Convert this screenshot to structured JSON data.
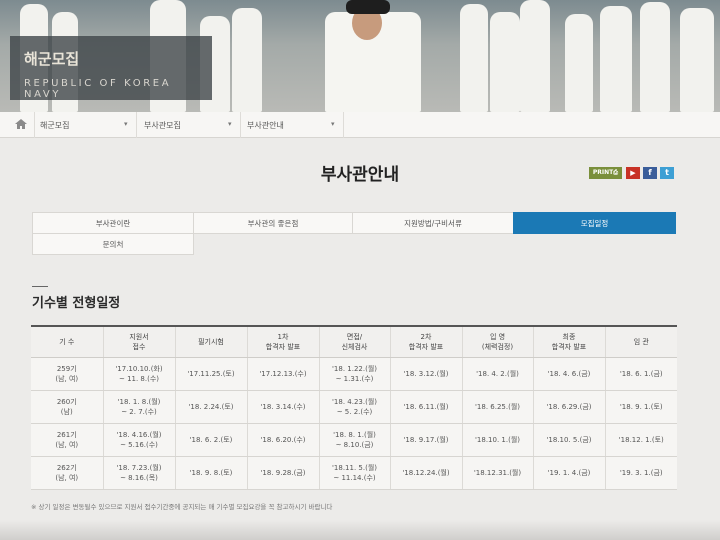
{
  "hero": {
    "title": "해군모집",
    "subtitle": "REPUBLIC OF KOREA NAVY"
  },
  "breadcrumb": {
    "items": [
      "해군모집",
      "부사관모집",
      "부사관안내"
    ]
  },
  "page": {
    "title": "부사관안내"
  },
  "share": {
    "print_label": "PRINT⎙",
    "youtube_label": "▶",
    "facebook_label": "f",
    "twitter_label": "t"
  },
  "tabs": [
    {
      "label": "부사관이란",
      "active": false
    },
    {
      "label": "부사관의 좋은점",
      "active": false
    },
    {
      "label": "지원방법/구비서류",
      "active": false
    },
    {
      "label": "모집일정",
      "active": true
    },
    {
      "label": "문의처",
      "active": false
    }
  ],
  "section": {
    "title": "기수별 전형일정"
  },
  "table": {
    "headers": [
      "기 수",
      "지원서\n접수",
      "필기시험",
      "1차\n합격자 발표",
      "면접/\n신체검사",
      "2차\n합격자 발표",
      "입 영\n(체력검정)",
      "최종\n합격자 발표",
      "임 관"
    ],
    "rows": [
      [
        "259기\n(남, 여)",
        "'17.10.10.(화)\n~ 11. 8.(수)",
        "'17.11.25.(토)",
        "'17.12.13.(수)",
        "'18. 1.22.(월)\n~ 1.31.(수)",
        "'18. 3.12.(월)",
        "'18. 4. 2.(월)",
        "'18. 4. 6.(금)",
        "'18. 6. 1.(금)"
      ],
      [
        "260기\n(남)",
        "'18. 1. 8.(월)\n~ 2. 7.(수)",
        "'18. 2.24.(토)",
        "'18. 3.14.(수)",
        "'18. 4.23.(월)\n~ 5. 2.(수)",
        "'18. 6.11.(월)",
        "'18. 6.25.(월)",
        "'18. 6.29.(금)",
        "'18. 9. 1.(토)"
      ],
      [
        "261기\n(남, 여)",
        "'18. 4.16.(월)\n~ 5.16.(수)",
        "'18. 6. 2.(토)",
        "'18. 6.20.(수)",
        "'18. 8. 1.(월)\n~ 8.10.(금)",
        "'18. 9.17.(월)",
        "'18.10. 1.(월)",
        "'18.10. 5.(금)",
        "'18.12. 1.(토)"
      ],
      [
        "262기\n(남, 여)",
        "'18. 7.23.(월)\n~ 8.16.(목)",
        "'18. 9. 8.(토)",
        "'18. 9.28.(금)",
        "'18.11. 5.(월)\n~ 11.14.(수)",
        "'18.12.24.(월)",
        "'18.12.31.(월)",
        "'19. 1. 4.(금)",
        "'19. 3. 1.(금)"
      ]
    ]
  },
  "footnote": "※ 상기 일정은 변동될수 있으므로 지원서 접수기간중에 공지되는 매 기수별 모집요강을 꼭 참고하시기 바랍니다",
  "colors": {
    "accent": "#1b79b5",
    "print": "#7a8f3b",
    "youtube": "#c83226",
    "facebook": "#3a5d9a",
    "twitter": "#3d9fd4"
  }
}
